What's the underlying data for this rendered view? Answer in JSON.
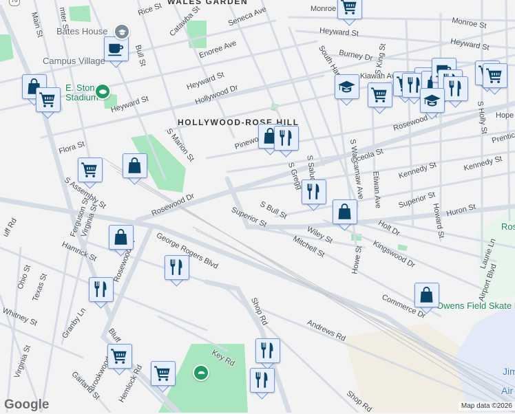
{
  "map": {
    "route_shield": "76",
    "pois": {
      "bates_house": "Bates House",
      "campus_village": "Campus Village",
      "stadium_line1": "E. Stone",
      "stadium_line2": "Stadium",
      "neighborhood": "HOLLYWOOD-ROSE HILL",
      "skate_park": "Owens Field Skate Park",
      "rosewood_park": "Ros",
      "airport_line1": "Jim",
      "airport_line2": "Air"
    },
    "streets": [
      "Rice St",
      "Catawba St",
      "Seneca Ave",
      "Enoree Ave",
      "Heyward St",
      "Hollywood Dr",
      "Heyward St",
      "Main St",
      "mter St",
      "Bull St",
      "Pinewood",
      "S Marion St",
      "Flora St",
      "S Assembly St",
      "Rosewood Dr",
      "Ferguson St",
      "Virginia St",
      "Hamrick St",
      "uff Rd",
      "Rosewood Dr",
      "George Rogers Blvd",
      "Ohio St",
      "Texas St",
      "Whitney St",
      "Granby Ln",
      "Virginia St",
      "Bluff",
      "Brookwood",
      "Hemlock Rd",
      "Garland St",
      "Shop Rd",
      "Key Rd",
      "Andrews Rd",
      "Shop Rd",
      "Superior St",
      "S Bull St",
      "Wiley St",
      "Mitchell St",
      "Howe St",
      "Kingswood Dr",
      "Holt Dr",
      "Commerce Dr",
      "Howard St",
      "Huron St",
      "Laurie Ln",
      "Airport Blvd",
      "Superior St",
      "Kennedy St",
      "Kennedy St",
      "Oceola St",
      "Hope",
      "Prentice",
      "S Holly St",
      "Etiwan Ave",
      "S Waccamaw Ave",
      "S Gregg",
      "S Saluda",
      "Monroe",
      "Monroe St",
      "Heyward St",
      "Heyward St",
      "Burney Dr",
      "S King St",
      "South Harden St",
      "Kiawah Ave",
      "Rosewood Dr",
      "WALES GARDEN"
    ],
    "markers": [
      "shopping-cart",
      "coffee",
      "shopping-bag",
      "shopping-cart",
      "shopping-cart",
      "shopping-bag",
      "graduation-cap",
      "shopping-cart",
      "shopping-bag",
      "restaurant",
      "shopping-bag",
      "restaurant",
      "coffee",
      "restaurant",
      "restaurant",
      "shopping-cart",
      "shopping-cart",
      "graduation-cap",
      "shopping-cart",
      "shopping-bag",
      "restaurant",
      "restaurant",
      "shopping-bag",
      "shopping-bag",
      "restaurant",
      "restaurant",
      "shopping-cart",
      "shopping-cart",
      "restaurant",
      "restaurant",
      "shopping-bag"
    ],
    "colors": {
      "marker_icon": "#0b4468",
      "marker_bg": "#e7effc",
      "park": "#a8e5bf",
      "road": "#d5dce5"
    }
  },
  "footer": {
    "logo": "Google",
    "attribution": "Map data ©2026"
  }
}
